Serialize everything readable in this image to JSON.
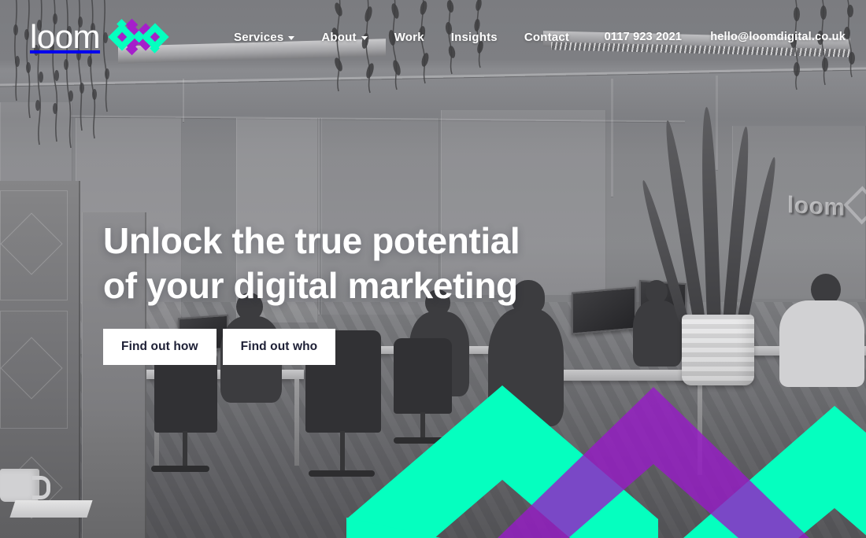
{
  "site": {
    "brand_word": "loom",
    "brand_mark_icon": "loom-diamond-logo-icon"
  },
  "header": {
    "nav": [
      {
        "label": "Services",
        "has_dropdown": true,
        "caret_icon": "chevron-down-icon"
      },
      {
        "label": "About",
        "has_dropdown": true,
        "caret_icon": "chevron-down-icon"
      },
      {
        "label": "Work",
        "has_dropdown": false,
        "caret_icon": ""
      },
      {
        "label": "Insights",
        "has_dropdown": false,
        "caret_icon": ""
      },
      {
        "label": "Contact",
        "has_dropdown": false,
        "caret_icon": ""
      }
    ],
    "phone": "0117 923 2021",
    "email": "hello@loomdigital.co.uk"
  },
  "hero": {
    "title_line_1": "Unlock the true potential",
    "title_line_2": "of your digital marketing",
    "buttons": [
      {
        "label": "Find out how"
      },
      {
        "label": "Find out who"
      }
    ]
  },
  "decor": {
    "wall_sign_text": "loom",
    "wall_sign_mark_icon": "loom-diamond-outline-icon"
  },
  "colors": {
    "accent_green": "#05FFBF",
    "accent_purple": "#A51FCB",
    "purple_overlay": "rgba(151,26,200,0.78)",
    "text_on_photo": "#FFFFFF",
    "button_bg": "#FFFFFF",
    "button_text": "#1D1F35",
    "photo_duotone": "#6E7183"
  }
}
